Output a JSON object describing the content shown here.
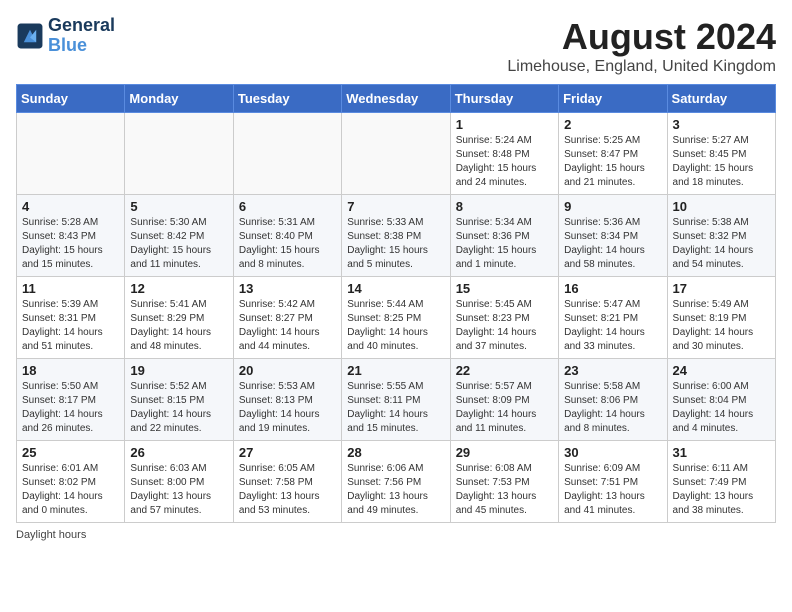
{
  "logo": {
    "line1": "General",
    "line2": "Blue"
  },
  "title": "August 2024",
  "subtitle": "Limehouse, England, United Kingdom",
  "columns": [
    "Sunday",
    "Monday",
    "Tuesday",
    "Wednesday",
    "Thursday",
    "Friday",
    "Saturday"
  ],
  "weeks": [
    [
      {
        "day": "",
        "info": ""
      },
      {
        "day": "",
        "info": ""
      },
      {
        "day": "",
        "info": ""
      },
      {
        "day": "",
        "info": ""
      },
      {
        "day": "1",
        "info": "Sunrise: 5:24 AM\nSunset: 8:48 PM\nDaylight: 15 hours\nand 24 minutes."
      },
      {
        "day": "2",
        "info": "Sunrise: 5:25 AM\nSunset: 8:47 PM\nDaylight: 15 hours\nand 21 minutes."
      },
      {
        "day": "3",
        "info": "Sunrise: 5:27 AM\nSunset: 8:45 PM\nDaylight: 15 hours\nand 18 minutes."
      }
    ],
    [
      {
        "day": "4",
        "info": "Sunrise: 5:28 AM\nSunset: 8:43 PM\nDaylight: 15 hours\nand 15 minutes."
      },
      {
        "day": "5",
        "info": "Sunrise: 5:30 AM\nSunset: 8:42 PM\nDaylight: 15 hours\nand 11 minutes."
      },
      {
        "day": "6",
        "info": "Sunrise: 5:31 AM\nSunset: 8:40 PM\nDaylight: 15 hours\nand 8 minutes."
      },
      {
        "day": "7",
        "info": "Sunrise: 5:33 AM\nSunset: 8:38 PM\nDaylight: 15 hours\nand 5 minutes."
      },
      {
        "day": "8",
        "info": "Sunrise: 5:34 AM\nSunset: 8:36 PM\nDaylight: 15 hours\nand 1 minute."
      },
      {
        "day": "9",
        "info": "Sunrise: 5:36 AM\nSunset: 8:34 PM\nDaylight: 14 hours\nand 58 minutes."
      },
      {
        "day": "10",
        "info": "Sunrise: 5:38 AM\nSunset: 8:32 PM\nDaylight: 14 hours\nand 54 minutes."
      }
    ],
    [
      {
        "day": "11",
        "info": "Sunrise: 5:39 AM\nSunset: 8:31 PM\nDaylight: 14 hours\nand 51 minutes."
      },
      {
        "day": "12",
        "info": "Sunrise: 5:41 AM\nSunset: 8:29 PM\nDaylight: 14 hours\nand 48 minutes."
      },
      {
        "day": "13",
        "info": "Sunrise: 5:42 AM\nSunset: 8:27 PM\nDaylight: 14 hours\nand 44 minutes."
      },
      {
        "day": "14",
        "info": "Sunrise: 5:44 AM\nSunset: 8:25 PM\nDaylight: 14 hours\nand 40 minutes."
      },
      {
        "day": "15",
        "info": "Sunrise: 5:45 AM\nSunset: 8:23 PM\nDaylight: 14 hours\nand 37 minutes."
      },
      {
        "day": "16",
        "info": "Sunrise: 5:47 AM\nSunset: 8:21 PM\nDaylight: 14 hours\nand 33 minutes."
      },
      {
        "day": "17",
        "info": "Sunrise: 5:49 AM\nSunset: 8:19 PM\nDaylight: 14 hours\nand 30 minutes."
      }
    ],
    [
      {
        "day": "18",
        "info": "Sunrise: 5:50 AM\nSunset: 8:17 PM\nDaylight: 14 hours\nand 26 minutes."
      },
      {
        "day": "19",
        "info": "Sunrise: 5:52 AM\nSunset: 8:15 PM\nDaylight: 14 hours\nand 22 minutes."
      },
      {
        "day": "20",
        "info": "Sunrise: 5:53 AM\nSunset: 8:13 PM\nDaylight: 14 hours\nand 19 minutes."
      },
      {
        "day": "21",
        "info": "Sunrise: 5:55 AM\nSunset: 8:11 PM\nDaylight: 14 hours\nand 15 minutes."
      },
      {
        "day": "22",
        "info": "Sunrise: 5:57 AM\nSunset: 8:09 PM\nDaylight: 14 hours\nand 11 minutes."
      },
      {
        "day": "23",
        "info": "Sunrise: 5:58 AM\nSunset: 8:06 PM\nDaylight: 14 hours\nand 8 minutes."
      },
      {
        "day": "24",
        "info": "Sunrise: 6:00 AM\nSunset: 8:04 PM\nDaylight: 14 hours\nand 4 minutes."
      }
    ],
    [
      {
        "day": "25",
        "info": "Sunrise: 6:01 AM\nSunset: 8:02 PM\nDaylight: 14 hours\nand 0 minutes."
      },
      {
        "day": "26",
        "info": "Sunrise: 6:03 AM\nSunset: 8:00 PM\nDaylight: 13 hours\nand 57 minutes."
      },
      {
        "day": "27",
        "info": "Sunrise: 6:05 AM\nSunset: 7:58 PM\nDaylight: 13 hours\nand 53 minutes."
      },
      {
        "day": "28",
        "info": "Sunrise: 6:06 AM\nSunset: 7:56 PM\nDaylight: 13 hours\nand 49 minutes."
      },
      {
        "day": "29",
        "info": "Sunrise: 6:08 AM\nSunset: 7:53 PM\nDaylight: 13 hours\nand 45 minutes."
      },
      {
        "day": "30",
        "info": "Sunrise: 6:09 AM\nSunset: 7:51 PM\nDaylight: 13 hours\nand 41 minutes."
      },
      {
        "day": "31",
        "info": "Sunrise: 6:11 AM\nSunset: 7:49 PM\nDaylight: 13 hours\nand 38 minutes."
      }
    ]
  ],
  "footer": "Daylight hours"
}
